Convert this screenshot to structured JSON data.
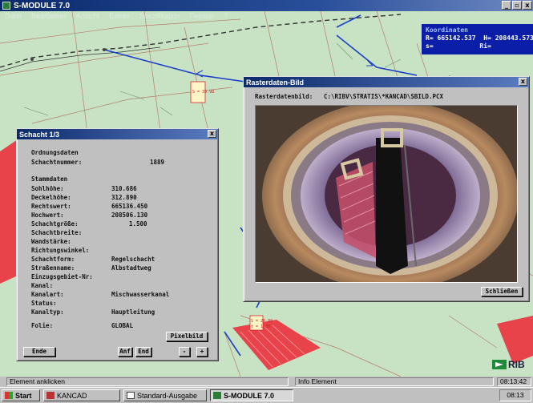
{
  "app": {
    "title": "S-MODULE 7.0",
    "menu": [
      "Datei",
      "Bearbeiten",
      "Ansicht",
      "Extras",
      "Spezifikation",
      "Fenster",
      "?"
    ]
  },
  "coordinates": {
    "title": "Koordinaten",
    "line1": "R= 665142.537  H= 208443.573",
    "line2": "s=            Ri="
  },
  "map_labels": {
    "label1": "S = 39.98",
    "label2": "S = 20.00",
    "label3": "t = 1.38"
  },
  "schacht": {
    "title": "Schacht 1/3",
    "close": "x",
    "ordnungsdaten": "Ordnungsdaten",
    "schachtnummer_label": "Schachtnummer:",
    "schachtnummer": "1889",
    "stammdaten": "Stammdaten",
    "fields": [
      {
        "label": "Sohlhöhe:",
        "value": "310.686"
      },
      {
        "label": "Deckelhöhe:",
        "value": "312.890"
      },
      {
        "label": "Rechtswert:",
        "value": "665136.450"
      },
      {
        "label": "Hochwert:",
        "value": "208506.130"
      },
      {
        "label": "Schachtgröße:",
        "value": "1.500"
      },
      {
        "label": "Schachtbreite:",
        "value": ""
      },
      {
        "label": "Wandstärke:",
        "value": ""
      },
      {
        "label": "Richtungswinkel:",
        "value": ""
      },
      {
        "label": "Schachtform:",
        "value": "Regelschacht"
      },
      {
        "label": "Straßenname:",
        "value": "Albstadtweg"
      },
      {
        "label": "Einzugsgebiet-Nr:",
        "value": ""
      },
      {
        "label": "Kanal:",
        "value": ""
      },
      {
        "label": "Kanalart:",
        "value": "Mischwasserkanal"
      },
      {
        "label": "Status:",
        "value": ""
      },
      {
        "label": "Kanaltyp:",
        "value": "Hauptleitung"
      }
    ],
    "folie_label": "Folie:",
    "folie": "GLOBAL",
    "buttons": {
      "pixelbild": "Pixelbild",
      "ende": "Ende",
      "anf": "Anf",
      "end": "End",
      "prev": "-",
      "next": "+"
    }
  },
  "raster": {
    "title": "Rasterdaten-Bild",
    "close": "x",
    "label": "Rasterdatenbild:",
    "path": "C:\\RIBV\\STRATIS\\*KANCAD\\SBILD.PCX",
    "close_button": "Schließen"
  },
  "statusbar": {
    "left": "Element anklicken",
    "middle": "Info Element",
    "time": "08:13:42"
  },
  "taskbar": {
    "start": "Start",
    "items": [
      "KANCAD",
      "Standard-Ausgabe",
      "S-MODULE 7.0"
    ],
    "clock": "08:13"
  },
  "logo_text": "RIB",
  "colors": {
    "map_bg": "#c7e3c4",
    "coords_bg": "#0a1ea8",
    "title_bar": "#0a2a6b",
    "parcel_red": "#e8424a"
  }
}
